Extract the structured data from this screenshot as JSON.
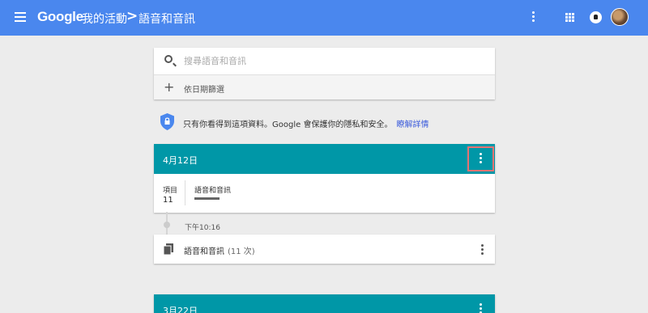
{
  "header": {
    "logo": "Google",
    "breadcrumb_parent": "我的活動",
    "breadcrumb_separator": ">",
    "breadcrumb_current": "語音和音訊",
    "icons": [
      "menu-icon",
      "more-vert-icon",
      "apps-grid-icon",
      "notifications-icon",
      "avatar"
    ],
    "color": "#4a87ee"
  },
  "search": {
    "placeholder": "搜尋語音和音訊",
    "filter_label": "依日期篩選"
  },
  "privacy": {
    "text": "只有你看得到這項資料。Google 會保護你的隱私和安全。",
    "link": "瞭解詳情"
  },
  "days": [
    {
      "date": "4月12日",
      "items_label": "項目",
      "items_count": "11",
      "product_label": "語音和音訊",
      "header_color": "#0097a7"
    },
    {
      "date": "3月22日",
      "header_color": "#0097a7"
    }
  ],
  "entry": {
    "time": "下午10:16",
    "title": "語音和音訊",
    "count": "(11 次)"
  }
}
